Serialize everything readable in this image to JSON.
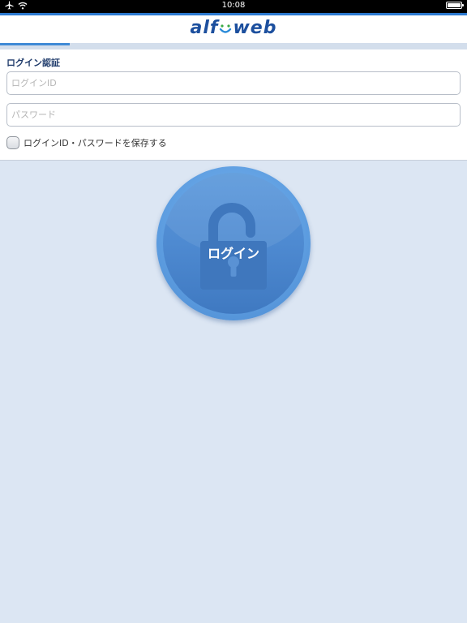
{
  "status_bar": {
    "time": "10:08"
  },
  "header": {
    "logo_left": "alf",
    "logo_right": "web"
  },
  "form": {
    "section_title": "ログイン認証",
    "login_id": {
      "placeholder": "ログインID",
      "value": ""
    },
    "password": {
      "placeholder": "パスワード",
      "value": ""
    },
    "remember": {
      "label": "ログインID・パスワードを保存する",
      "checked": false
    }
  },
  "login_button": {
    "label": "ログイン"
  },
  "colors": {
    "background": "#dce6f3",
    "brand": "#1c4f9e",
    "accent": "#2c7ad0",
    "button": "#5d9de0"
  }
}
